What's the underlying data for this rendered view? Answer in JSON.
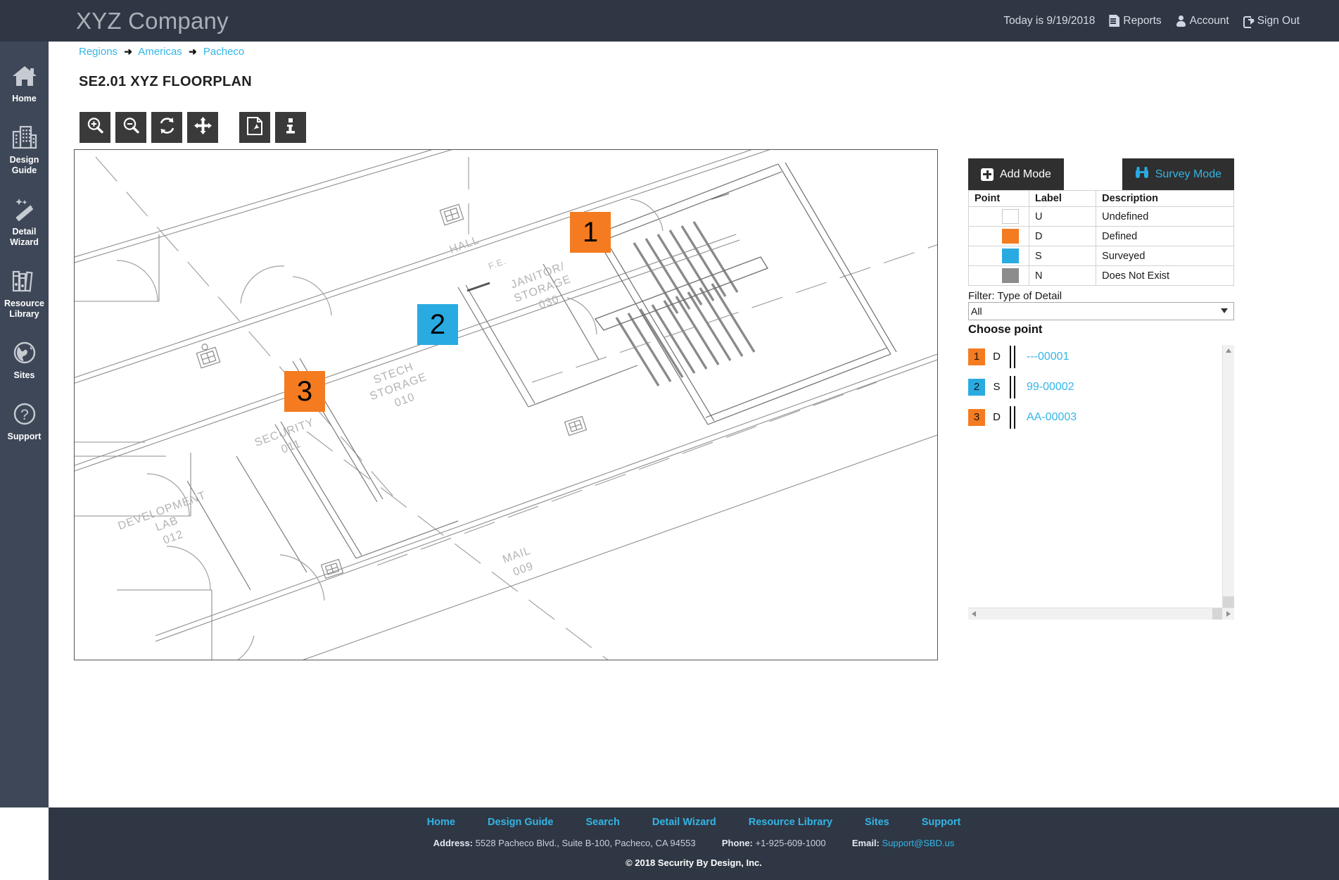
{
  "header": {
    "brand": "XYZ Company",
    "today": "Today is 9/19/2018",
    "reports": "Reports",
    "account": "Account",
    "sign_out": "Sign Out"
  },
  "sidebar": {
    "items": [
      {
        "label": "Home",
        "icon": "home-icon"
      },
      {
        "label": "Design\nGuide",
        "line1": "Design",
        "line2": "Guide",
        "icon": "building-icon"
      },
      {
        "label": "Detail\nWizard",
        "line1": "Detail",
        "line2": "Wizard",
        "icon": "wand-icon"
      },
      {
        "label": "Resource\nLibrary",
        "line1": "Resource",
        "line2": "Library",
        "icon": "books-icon"
      },
      {
        "label": "Sites",
        "line1": "Sites",
        "line2": "",
        "icon": "globe-icon"
      },
      {
        "label": "Support",
        "line1": "Support",
        "line2": "",
        "icon": "question-icon"
      }
    ]
  },
  "breadcrumb": {
    "items": [
      "Regions",
      "Americas",
      "Pacheco"
    ],
    "separator": "➜"
  },
  "page": {
    "title": "SE2.01 XYZ FLOORPLAN"
  },
  "toolbar": {
    "buttons": [
      {
        "name": "zoom-in-icon",
        "title": "Zoom In"
      },
      {
        "name": "zoom-out-icon",
        "title": "Zoom Out"
      },
      {
        "name": "refresh-icon",
        "title": "Reset"
      },
      {
        "name": "move-icon",
        "title": "Pan"
      },
      {
        "name": "pdf-icon",
        "title": "Export PDF"
      },
      {
        "name": "info-icon",
        "title": "Info"
      }
    ]
  },
  "floorplan": {
    "rooms": [
      {
        "name": "HALL",
        "number": ""
      },
      {
        "name": "F.E.",
        "number": ""
      },
      {
        "name": "JANITOR/",
        "name2": "STORAGE",
        "number": "030"
      },
      {
        "name": "STECH",
        "name2": "STORAGE",
        "number": "010"
      },
      {
        "name": "SECURITY",
        "number": "011"
      },
      {
        "name": "DEVELOPMENT",
        "name2": "LAB",
        "number": "012"
      },
      {
        "name": "MAIL",
        "number": "009"
      }
    ],
    "markers": [
      {
        "number": "1",
        "color": "#f47b20",
        "status": "D"
      },
      {
        "number": "2",
        "color": "#29abe2",
        "status": "S"
      },
      {
        "number": "3",
        "color": "#f47b20",
        "status": "D"
      }
    ]
  },
  "right_panel": {
    "add_mode": "Add Mode",
    "survey_mode": "Survey Mode",
    "legend": {
      "headers": [
        "Point",
        "Label",
        "Description"
      ],
      "rows": [
        {
          "color": "#ffffff",
          "label": "U",
          "description": "Undefined"
        },
        {
          "color": "#f47b20",
          "label": "D",
          "description": "Defined"
        },
        {
          "color": "#29abe2",
          "label": "S",
          "description": "Surveyed"
        },
        {
          "color": "#8c8c8c",
          "label": "N",
          "description": "Does Not Exist"
        }
      ]
    },
    "filter_label": "Filter: Type of Detail",
    "filter_value": "All",
    "filter_options": [
      "All"
    ],
    "choose_point_label": "Choose point",
    "points": [
      {
        "number": "1",
        "color": "#f47b20",
        "type": "D",
        "id": "---00001"
      },
      {
        "number": "2",
        "color": "#29abe2",
        "type": "S",
        "id": "99-00002"
      },
      {
        "number": "3",
        "color": "#f47b20",
        "type": "D",
        "id": "AA-00003"
      }
    ]
  },
  "footer": {
    "links": [
      "Home",
      "Design Guide",
      "Search",
      "Detail Wizard",
      "Resource Library",
      "Sites",
      "Support"
    ],
    "address_label": "Address:",
    "address": "5528 Pacheco Blvd., Suite B-100, Pacheco, CA 94553",
    "phone_label": "Phone:",
    "phone": "+1-925-609-1000",
    "email_label": "Email:",
    "email": "Support@SBD.us",
    "copyright": "© 2018 Security By Design, Inc."
  },
  "colors": {
    "defined": "#f47b20",
    "surveyed": "#29abe2",
    "dark": "#2f3744",
    "accent": "#33b5e5"
  }
}
